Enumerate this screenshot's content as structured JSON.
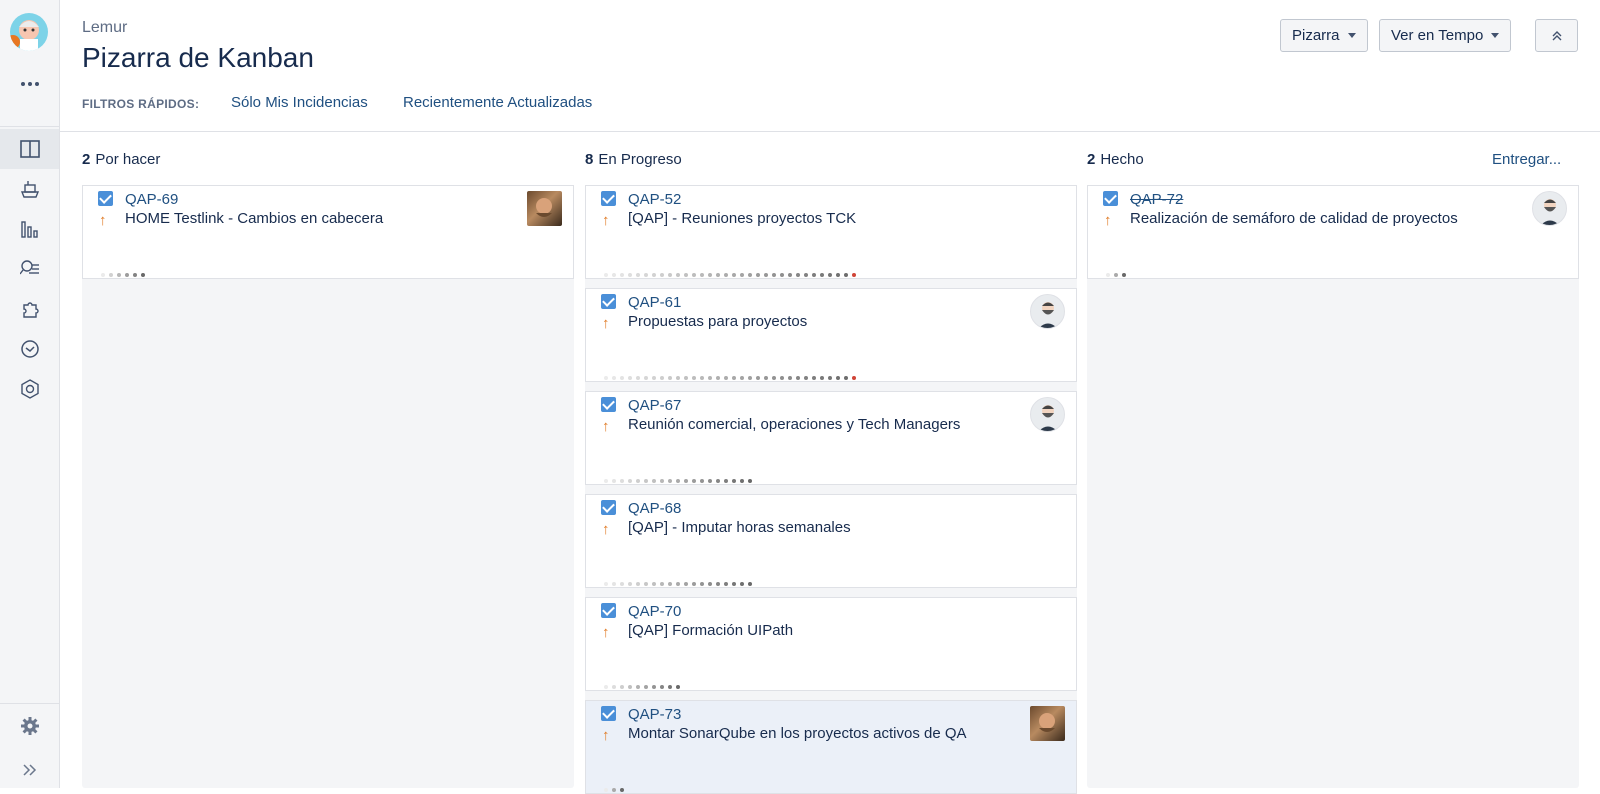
{
  "sidebar": {
    "icons": [
      "project-avatar-icon",
      "more-icon",
      "board-icon",
      "ship-icon",
      "reports-icon",
      "search-issues-icon",
      "puzzle-icon",
      "time-icon",
      "hexagon-icon",
      "settings-icon",
      "expand-icon"
    ]
  },
  "header": {
    "project": "Lemur",
    "title": "Pizarra de Kanban",
    "quick_filters_label": "FILTROS RÁPIDOS:",
    "quick_filters": [
      "Sólo Mis Incidencias",
      "Recientemente Actualizadas"
    ],
    "board_button": "Pizarra",
    "tempo_button": "Ver en Tempo"
  },
  "columns": [
    {
      "count": "2",
      "name": "Por hacer",
      "cards": [
        {
          "key": "QAP-69",
          "summary": "HOME Testlink - Cambios en cabecera",
          "avatar": "photo",
          "dots": 6,
          "done": false,
          "selected": false
        }
      ]
    },
    {
      "count": "8",
      "name": "En Progreso",
      "cards": [
        {
          "key": "QAP-52",
          "summary": "[QAP] - Reuniones proyectos TCK",
          "avatar": "",
          "dots": 32,
          "done": false,
          "selected": false
        },
        {
          "key": "QAP-61",
          "summary": "Propuestas para proyectos",
          "avatar": "round",
          "dots": 32,
          "done": false,
          "selected": false
        },
        {
          "key": "QAP-67",
          "summary": "Reunión comercial, operaciones y Tech Managers",
          "avatar": "round",
          "dots": 19,
          "done": false,
          "selected": false
        },
        {
          "key": "QAP-68",
          "summary": "[QAP] - Imputar horas semanales",
          "avatar": "",
          "dots": 19,
          "done": false,
          "selected": false
        },
        {
          "key": "QAP-70",
          "summary": "[QAP] Formación UIPath",
          "avatar": "",
          "dots": 10,
          "done": false,
          "selected": false
        },
        {
          "key": "QAP-73",
          "summary": "Montar SonarQube en los proyectos activos de QA",
          "avatar": "photo",
          "dots": 3,
          "done": false,
          "selected": true
        }
      ]
    },
    {
      "count": "2",
      "name": "Hecho",
      "release_link": "Entregar...",
      "cards": [
        {
          "key": "QAP-72",
          "summary": "Realización de semáforo de calidad de proyectos",
          "avatar": "round",
          "dots": 3,
          "done": true,
          "selected": false
        }
      ]
    }
  ],
  "colors": {
    "link": "#205081",
    "priority": "#e07b26",
    "checkbox": "#4a8fd8",
    "dot_red": "#d04437"
  }
}
